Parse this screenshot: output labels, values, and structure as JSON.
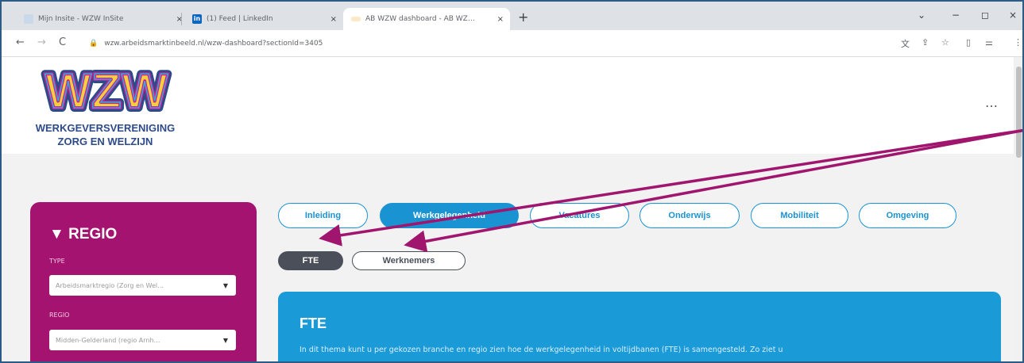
{
  "browser": {
    "tabs": [
      {
        "title": "Mijn Insite - WZW InSite",
        "close": "×"
      },
      {
        "title": "(1) Feed | LinkedIn",
        "close": "×"
      },
      {
        "title": "AB WZW dashboard - AB WZ…",
        "close": "×"
      }
    ],
    "new_tab": "+",
    "window_controls": [
      "⌄",
      "−",
      "◻",
      "×"
    ],
    "url": "wzw.arbeidsmarktinbeeld.nl/wzw-dashboard?sectionId=3405",
    "nav": {
      "back": "←",
      "forward": "→",
      "reload": "C"
    }
  },
  "header": {
    "logo_letters": "WZW",
    "logo_line1": "WERKGEVERSVERENIGING",
    "logo_line2": "ZORG EN WELZIJN",
    "menu_dots": "…",
    "colors": {
      "logo_blue": "#2d4a8a",
      "logo_yellow": "#f4d03f",
      "logo_pink": "#d81b8c",
      "logo_cyan": "#29aee3"
    }
  },
  "sidebar": {
    "heading": "▼ REGIO",
    "type_label": "TYPE",
    "type_value": "Arbeidsmarktregio (Zorg en Wel…",
    "regio_label": "REGIO",
    "regio_value": "Midden-Gelderland (regio Arnh…",
    "caret": "▼",
    "color": "#a3136f"
  },
  "tabs": [
    {
      "label": "Inleiding",
      "active": false
    },
    {
      "label": "Werkgelegenheid",
      "active": true
    },
    {
      "label": "Vacatures",
      "active": false
    },
    {
      "label": "Onderwijs",
      "active": false
    },
    {
      "label": "Mobiliteit",
      "active": false
    },
    {
      "label": "Omgeving",
      "active": false
    }
  ],
  "subtabs": [
    {
      "label": "FTE",
      "active": true
    },
    {
      "label": "Werknemers",
      "active": false
    }
  ],
  "card": {
    "title": "FTE",
    "text": "In dit thema kunt u per gekozen branche en regio zien hoe de werkgelegenheid in voltijdbanen (FTE) is samengesteld. Zo ziet u",
    "color": "#1a9ad6"
  },
  "annotation_color": "#a0156e"
}
